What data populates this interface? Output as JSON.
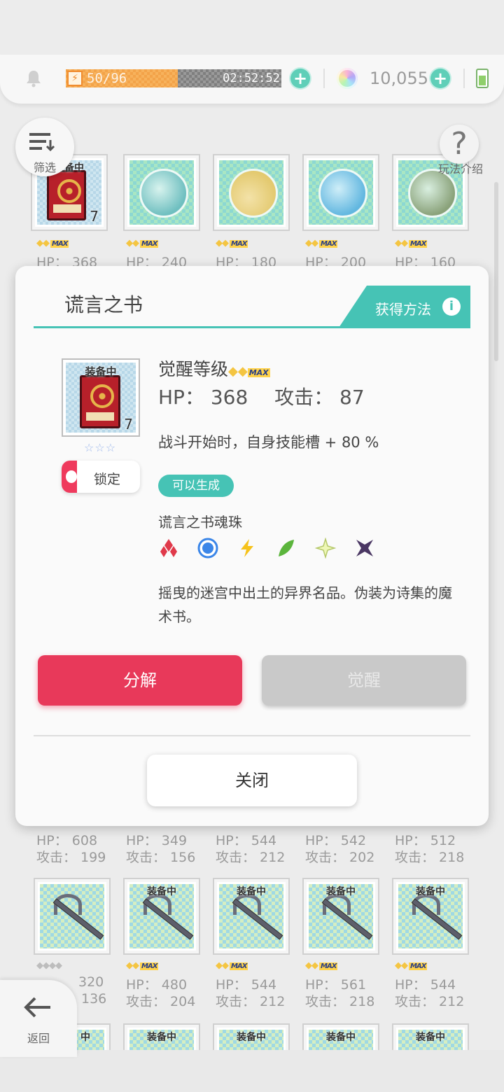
{
  "topbar": {
    "stamina_text": "50/96",
    "stamina_fraction": 0.52,
    "stamina_timer": "02:52:52",
    "gem_count": "10,055",
    "icons": [
      "bell-icon",
      "bolt-icon",
      "plus-icon",
      "gem-icon",
      "battery-icon"
    ]
  },
  "controls": {
    "filter_label": "筛选",
    "help_label": "玩法介绍",
    "back_label": "返回"
  },
  "cards_top": [
    {
      "hp": "HP： 368",
      "equip": "装备中",
      "count": "7"
    },
    {
      "hp": "HP： 240"
    },
    {
      "hp": "HP： 180"
    },
    {
      "hp": "HP： 200"
    },
    {
      "hp": "HP： 160"
    }
  ],
  "cards_mid_stats": [
    {
      "hp": "HP： 608",
      "atk": "攻击： 199"
    },
    {
      "hp": "HP： 349",
      "atk": "攻击： 156"
    },
    {
      "hp": "HP： 544",
      "atk": "攻击： 212"
    },
    {
      "hp": "HP： 542",
      "atk": "攻击： 202"
    },
    {
      "hp": "HP： 512",
      "atk": "攻击： 218"
    }
  ],
  "cards_weapons": [
    {
      "equip": "",
      "hp": "320",
      "atk": "136"
    },
    {
      "equip": "装备中",
      "hp": "HP： 480",
      "atk": "攻击： 204"
    },
    {
      "equip": "装备中",
      "hp": "HP： 544",
      "atk": "攻击： 212"
    },
    {
      "equip": "装备中",
      "hp": "HP： 561",
      "atk": "攻击： 218"
    },
    {
      "equip": "装备中",
      "hp": "HP： 544",
      "atk": "攻击： 212"
    }
  ],
  "bottom_row_equip": [
    "中",
    "装备中",
    "装备中",
    "装备中",
    "装备中"
  ],
  "modal": {
    "title": "谎言之书",
    "obtain_label": "获得方法",
    "item_equip": "装备中",
    "item_count": "7",
    "item_stars": "☆☆☆",
    "lock_label": "锁定",
    "awaken_label": "觉醒等级",
    "max_label": "MAX",
    "hp_label": "HP：",
    "hp_value": "368",
    "atk_label": "攻击：",
    "atk_value": "87",
    "skill_desc": "战斗开始时，自身技能槽 + 80 %",
    "can_generate": "可以生成",
    "soul_title": "谎言之书魂珠",
    "flavor": "摇曳的迷宫中出土的异界名品。伪装为诗集的魔术书。",
    "dismantle": "分解",
    "awaken": "觉醒",
    "close": "关闭",
    "soul_icons": [
      "red-diamond-icon",
      "blue-circle-icon",
      "yellow-bolt-icon",
      "green-leaf-icon",
      "light-star-icon",
      "purple-star-icon"
    ]
  },
  "colors": {
    "accent": "#46c3b5",
    "danger": "#e8395a",
    "stamina": "#f7b25c"
  }
}
